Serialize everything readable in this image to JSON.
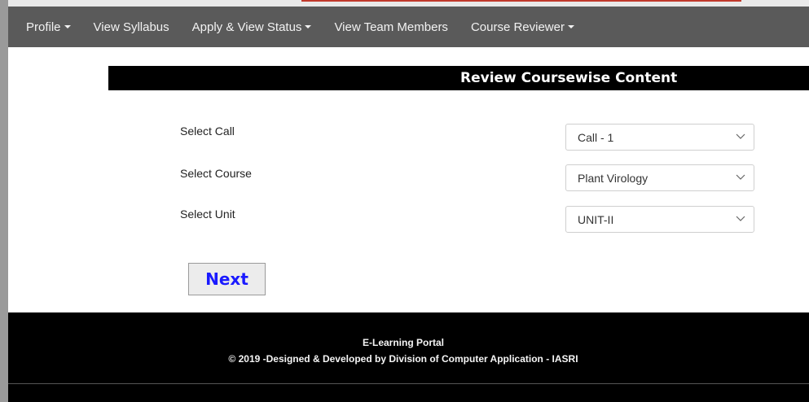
{
  "nav": {
    "items": [
      {
        "label": "Profile",
        "caret": true
      },
      {
        "label": "View Syllabus",
        "caret": false
      },
      {
        "label": "Apply & View Status",
        "caret": true
      },
      {
        "label": "View Team Members",
        "caret": false
      },
      {
        "label": "Course Reviewer",
        "caret": true
      }
    ]
  },
  "page": {
    "title": "Review Coursewise Content"
  },
  "form": {
    "call_label": "Select Call",
    "call_value": "Call - 1",
    "course_label": "Select Course",
    "course_value": "Plant Virology",
    "unit_label": "Select Unit",
    "unit_value": "UNIT-II",
    "next_label": "Next"
  },
  "footer": {
    "line1": "E-Learning Portal",
    "line2": "© 2019 -Designed & Developed by Division of Computer Application - IASRI"
  },
  "colors": {
    "navbar_bg": "#5a5a5a",
    "title_bar_bg": "#000000",
    "next_text": "#1a1aff",
    "footer_bg": "#000000"
  }
}
